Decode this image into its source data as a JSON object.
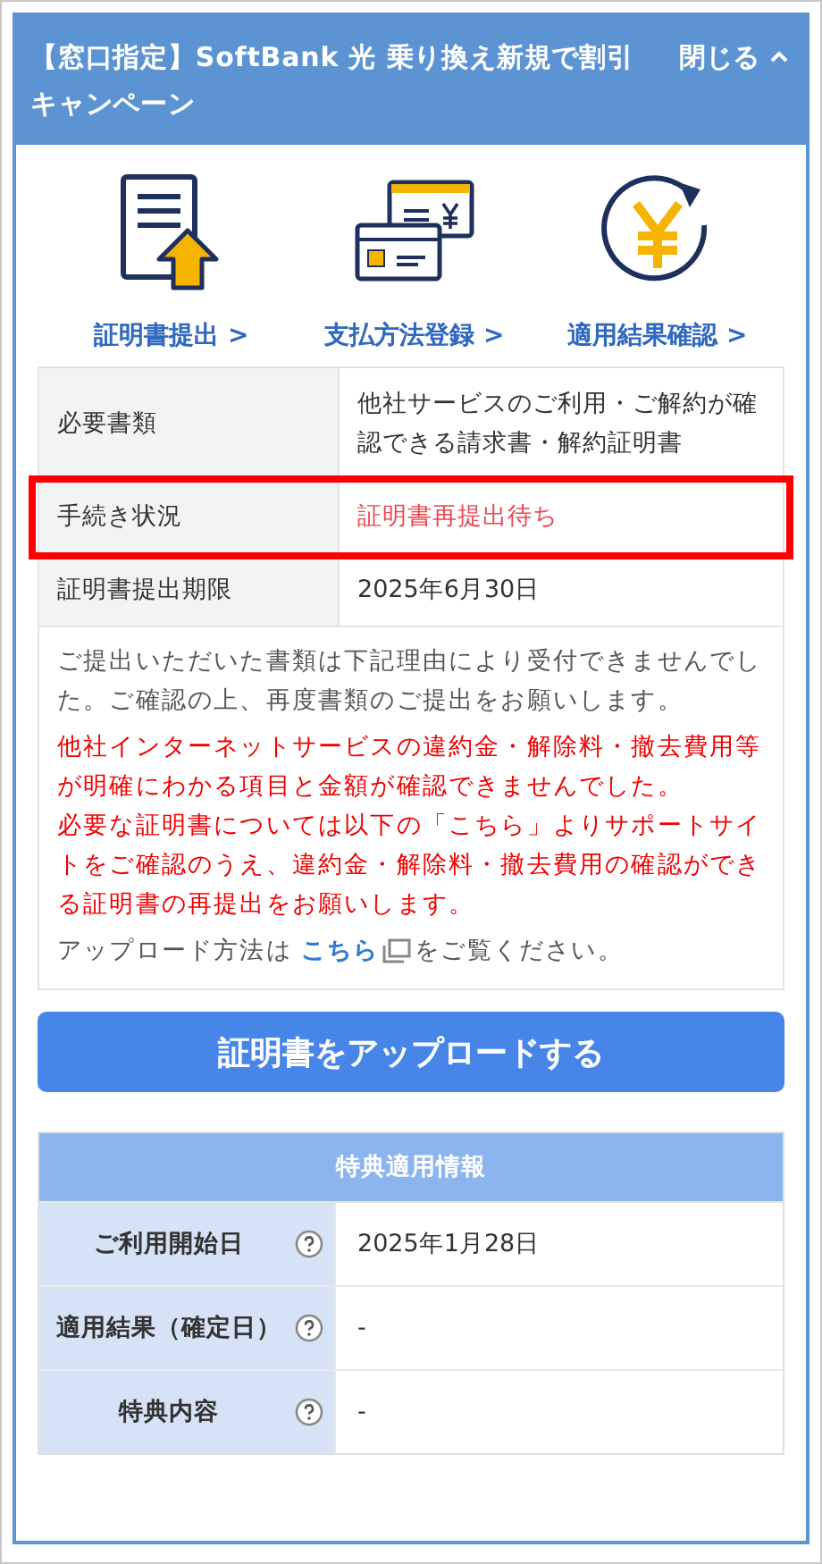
{
  "panel": {
    "title": "【窓口指定】SoftBank 光 乗り換え新規で割引キャンペーン",
    "toggle_label": "閉じる",
    "expanded": true
  },
  "shortcuts": [
    {
      "kind": "document",
      "label": "証明書提出 >"
    },
    {
      "kind": "cards",
      "label": "支払方法登録 >"
    },
    {
      "kind": "yen",
      "label": "適用結果確認 >"
    }
  ],
  "info_table": {
    "rows": [
      {
        "label": "必要書類",
        "value": "他社サービスのご利用・ご解約が確認できる請求書・解約証明書",
        "alert": false,
        "highlighted": false
      },
      {
        "label": "手続き状況",
        "value": "証明書再提出待ち",
        "alert": true,
        "highlighted": true
      },
      {
        "label": "証明書提出期限",
        "value": "2025年6月30日",
        "alert": false,
        "highlighted": false
      }
    ]
  },
  "note": {
    "message": "ご提出いただいた書類は下記理由により受付できませんでした。ご確認の上、再度書類のご提出をお願いします。",
    "reasons": [
      "他社インターネットサービスの違約金・解除料・撤去費用等が明確にわかる項目と金額が確認できませんでした。",
      "必要な証明書については以下の「こちら」よりサポートサイトをご確認のうえ、違約金・解除料・撤去費用の確認ができる証明書の再提出をお願いします。"
    ],
    "instructions": {
      "before": "アップロード方法は",
      "link": "こちら",
      "after": "をご覧ください。"
    }
  },
  "upload_button": "証明書をアップロードする",
  "benefits": {
    "title": "特典適用情報",
    "rows": [
      {
        "label": "ご利用開始日",
        "value": "2025年1月28日"
      },
      {
        "label": "適用結果（確定日）",
        "value": "-"
      },
      {
        "label": "特典内容",
        "value": "-"
      }
    ]
  }
}
